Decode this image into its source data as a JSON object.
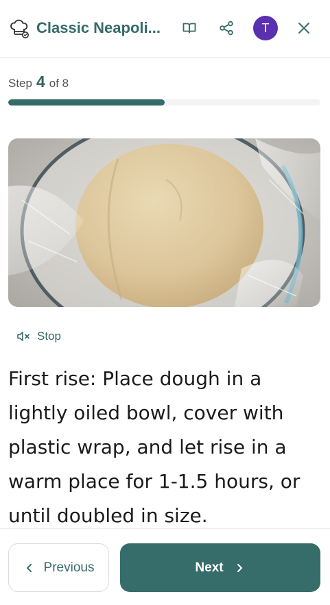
{
  "header": {
    "recipe_title": "Classic Neapoli...",
    "avatar_initial": "T",
    "icons": {
      "logo": "chef-hat-icon",
      "book": "book-icon",
      "share": "share-icon",
      "close": "close-icon"
    }
  },
  "step": {
    "prefix": "Step",
    "current": "4",
    "of_label": "of 8",
    "progress_fraction": 0.5
  },
  "image": {
    "description_icon": "dough-in-bowl-photo"
  },
  "audio": {
    "label": "Stop",
    "icon": "speaker-muted-icon"
  },
  "instruction": {
    "text": "First rise: Place dough in a lightly oiled bowl, cover with plastic wrap, and let rise in a warm place for 1-1.5 hours, or until doubled in size."
  },
  "footer": {
    "previous_label": "Previous",
    "next_label": "Next"
  },
  "colors": {
    "accent": "#356b69",
    "avatar": "#5a2fb0"
  }
}
